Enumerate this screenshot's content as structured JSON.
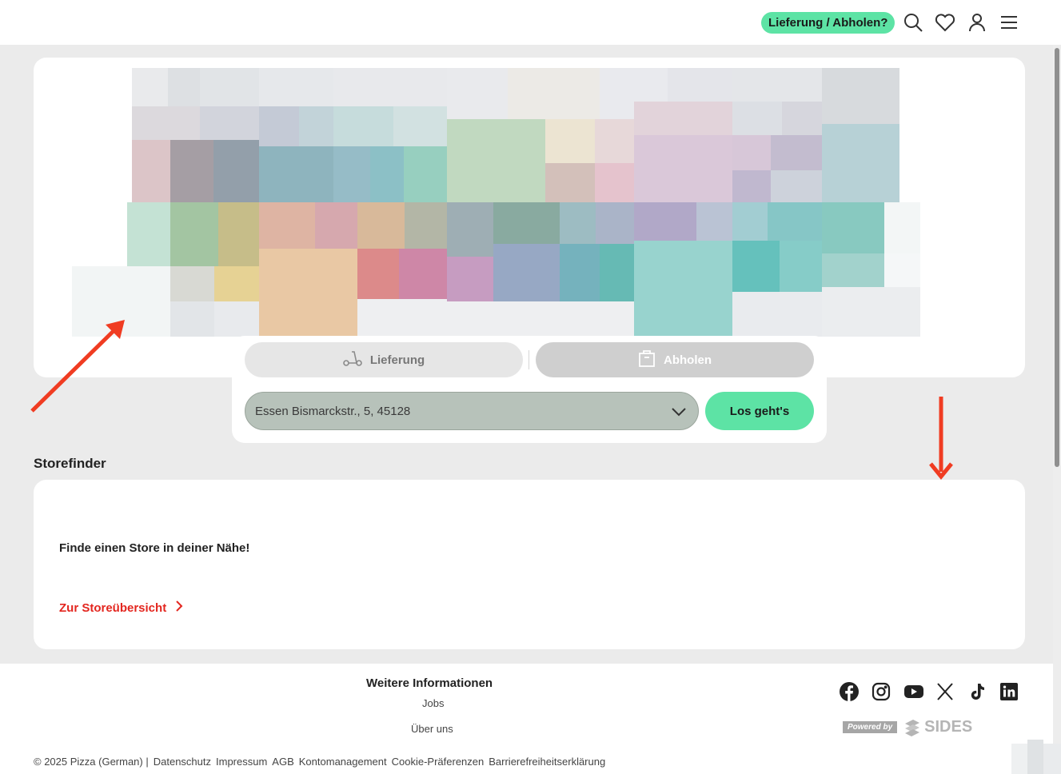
{
  "header": {
    "delivery_pickup_label": "Lieferung / Abholen?",
    "icons": [
      "search-icon",
      "heart-icon",
      "user-icon",
      "menu-icon"
    ]
  },
  "order": {
    "tab_delivery": "Lieferung",
    "tab_pickup": "Abholen",
    "address_value": "Essen Bismarckstr., 5, 45128",
    "go_button": "Los geht's"
  },
  "storefinder": {
    "section_title": "Storefinder",
    "lead": "Finde einen Store in deiner Nähe!",
    "link": "Zur Storeübersicht"
  },
  "footer": {
    "info_title": "Weitere Informationen",
    "links": [
      "Jobs",
      "Über uns"
    ],
    "socials": [
      "facebook-icon",
      "instagram-icon",
      "youtube-icon",
      "x-icon",
      "tiktok-icon",
      "linkedin-icon"
    ],
    "powered_by": "Powered by",
    "brand": "SIDES",
    "copyright": "© 2025 Pizza (German) |",
    "legal_links": [
      "Datenschutz",
      "Impressum",
      "AGB",
      "Kontomanagement",
      "Cookie-Präferenzen",
      "Barrierefreiheitserklärung"
    ]
  },
  "colors": {
    "accent_green": "#5de3a5",
    "link_red": "#e3261f",
    "annotation_arrow": "#f03c22"
  }
}
